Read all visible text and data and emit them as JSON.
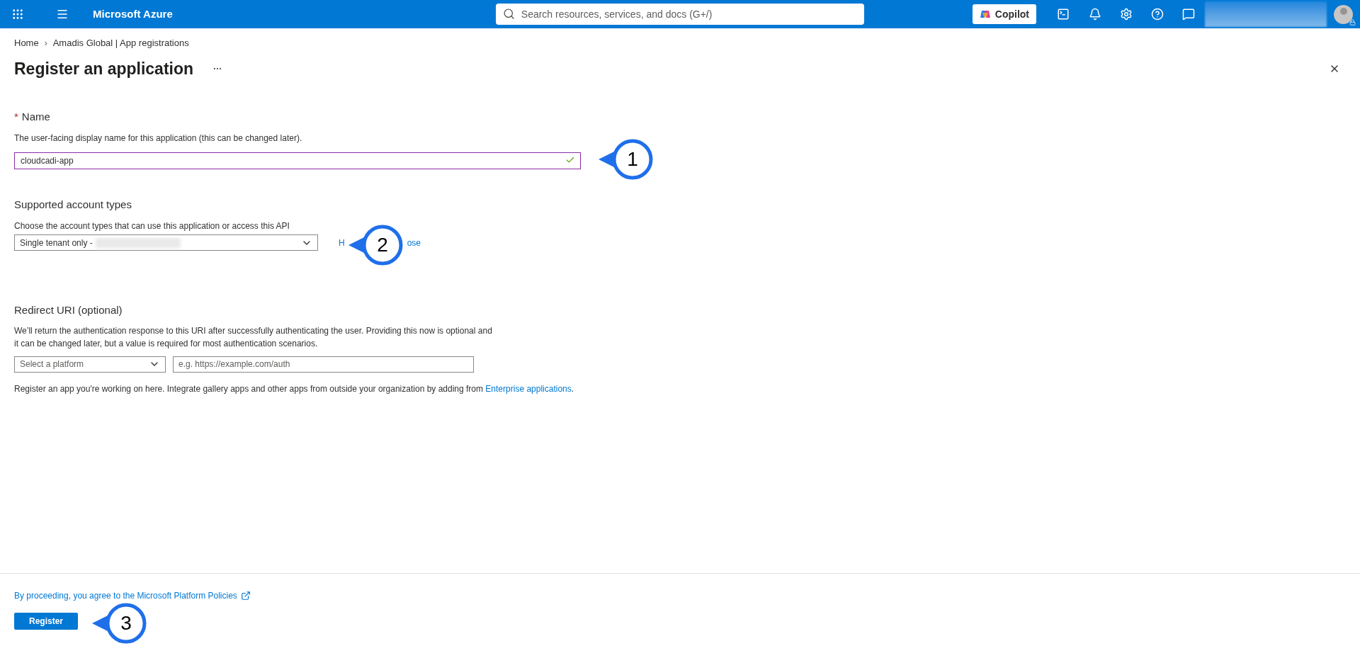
{
  "topbar": {
    "brand": "Microsoft Azure",
    "search": {
      "placeholder": "Search resources, services, and docs (G+/)"
    },
    "copilot": "Copilot"
  },
  "breadcrumb": [
    "Home",
    "Amadis Global | App registrations"
  ],
  "breadcrumb_separator": "›",
  "page": {
    "title": "Register an application"
  },
  "name_section": {
    "required": true,
    "required_mark": "*",
    "label": "Name",
    "description": "The user-facing display name for this application (this can be changed later).",
    "value": "cloudcadi-app",
    "valid": true
  },
  "account_types": {
    "heading": "Supported account types",
    "description": "Choose the account types that can use this application or access this API",
    "value": "Single tenant only -",
    "help_link": {
      "visible_start": "H",
      "visible_end": "ose"
    }
  },
  "redirect": {
    "heading": "Redirect URI (optional)",
    "description": "We’ll return the authentication response to this URI after successfully authenticating the user. Providing this now is optional and it can be changed later, but a value is required for most authentication scenarios.",
    "platform": {
      "placeholder": "Select a platform"
    },
    "uri": {
      "placeholder": "e.g. https://example.com/auth"
    }
  },
  "note": {
    "text": "Register an app you're working on here. Integrate gallery apps and other apps from outside your organization by adding from",
    "link": "Enterprise applications",
    "end": "."
  },
  "footer": {
    "policy_link": "By proceeding, you agree to the Microsoft Platform Policies",
    "register": "Register"
  },
  "callouts": [
    "1",
    "2",
    "3"
  ]
}
